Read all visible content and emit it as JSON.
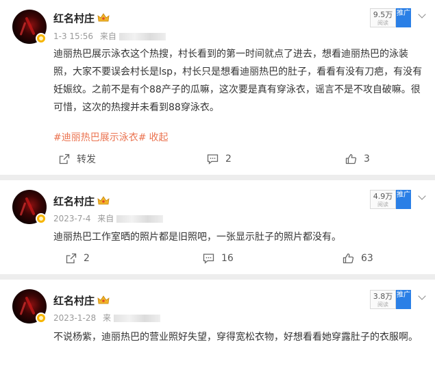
{
  "posts": [
    {
      "username": "红名村庄",
      "date": "1-3 15:56",
      "source_prefix": "来自",
      "views": "9.5万",
      "views_label": "阅读",
      "push_label": "推广",
      "text": "迪丽热巴展示泳衣这个热搜，村长看到的第一时间就点了进去，想看迪丽热巴的泳装照，大家不要误会村长是lsp，村长只是想看迪丽热巴的肚子，看看有没有刀疤，有没有妊娠纹。之前不是有个88产子的瓜嘛，这次要是真有穿泳衣，谣言不是不攻自破嘛。很可惜，这次的热搜并未看到88穿泳衣。",
      "hashtag": "#迪丽热巴展示泳衣#",
      "collapse": "收起",
      "repost": "转发",
      "comments": "2",
      "likes": "3"
    },
    {
      "username": "红名村庄",
      "date": "2023-7-4",
      "source_prefix": "来自",
      "views": "4.9万",
      "views_label": "阅读",
      "push_label": "推广",
      "text": "迪丽热巴工作室晒的照片都是旧照吧，一张显示肚子的照片都没有。",
      "repost": "2",
      "comments": "16",
      "likes": "63"
    },
    {
      "username": "红名村庄",
      "date": "2023-1-28",
      "source_prefix": "来",
      "views": "3.8万",
      "views_label": "阅读",
      "push_label": "推广",
      "text": "不说杨紫，迪丽热巴的营业照好失望，穿得宽松衣物，好想看看她穿露肚子的衣服啊。"
    }
  ],
  "colors": {
    "accent": "#eb7350",
    "push": "#2a7fe6",
    "badge": "#f7b500"
  }
}
